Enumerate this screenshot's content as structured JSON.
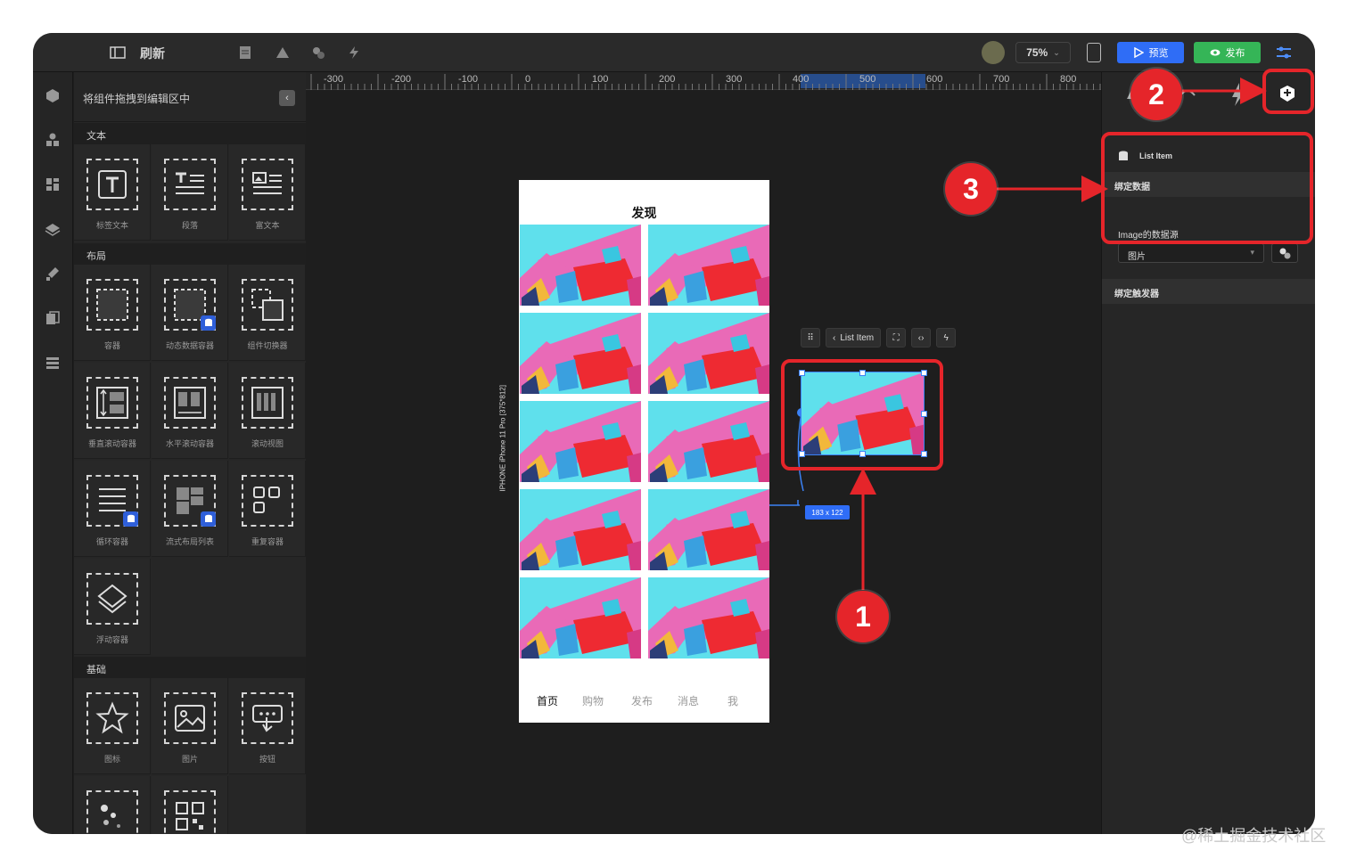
{
  "topbar": {
    "refresh_label": "刷新",
    "zoom": "75%",
    "preview_label": "预览",
    "publish_label": "发布"
  },
  "panel": {
    "header": "将组件拖拽到编辑区中",
    "sections": {
      "text": "文本",
      "layout": "布局",
      "basic": "基础"
    },
    "text_items": [
      "标签文本",
      "段落",
      "富文本"
    ],
    "layout_items": [
      "容器",
      "动态数据容器",
      "组件切换器",
      "垂直滚动容器",
      "水平滚动容器",
      "滚动视图",
      "循环容器",
      "流式布局列表",
      "重复容器",
      "浮动容器"
    ],
    "basic_items": [
      "图标",
      "图片",
      "按钮"
    ]
  },
  "ruler": {
    "labels": [
      "-300",
      "-200",
      "-100",
      "0",
      "100",
      "200",
      "300",
      "400",
      "500",
      "600",
      "700",
      "800"
    ]
  },
  "canvas": {
    "device_label": "IPHONE  iPhone 11 Pro [375*812]",
    "phone_title": "发现",
    "tabs": [
      "首页",
      "购物",
      "发布",
      "消息",
      "我"
    ],
    "item_toolbar_label": "List Item",
    "size_badge": "183 x 122"
  },
  "rpanel": {
    "crumb": "List Item",
    "bind_data": "绑定数据",
    "field_label": "Image的数据源",
    "field_value": "图片",
    "bind_trigger": "绑定触发器"
  },
  "annotations": [
    "1",
    "2",
    "3"
  ],
  "watermark": "@稀土掘金技术社区",
  "colors": {
    "accent_red": "#e5252a",
    "preview_blue": "#2f6df6",
    "publish_green": "#35b557"
  }
}
